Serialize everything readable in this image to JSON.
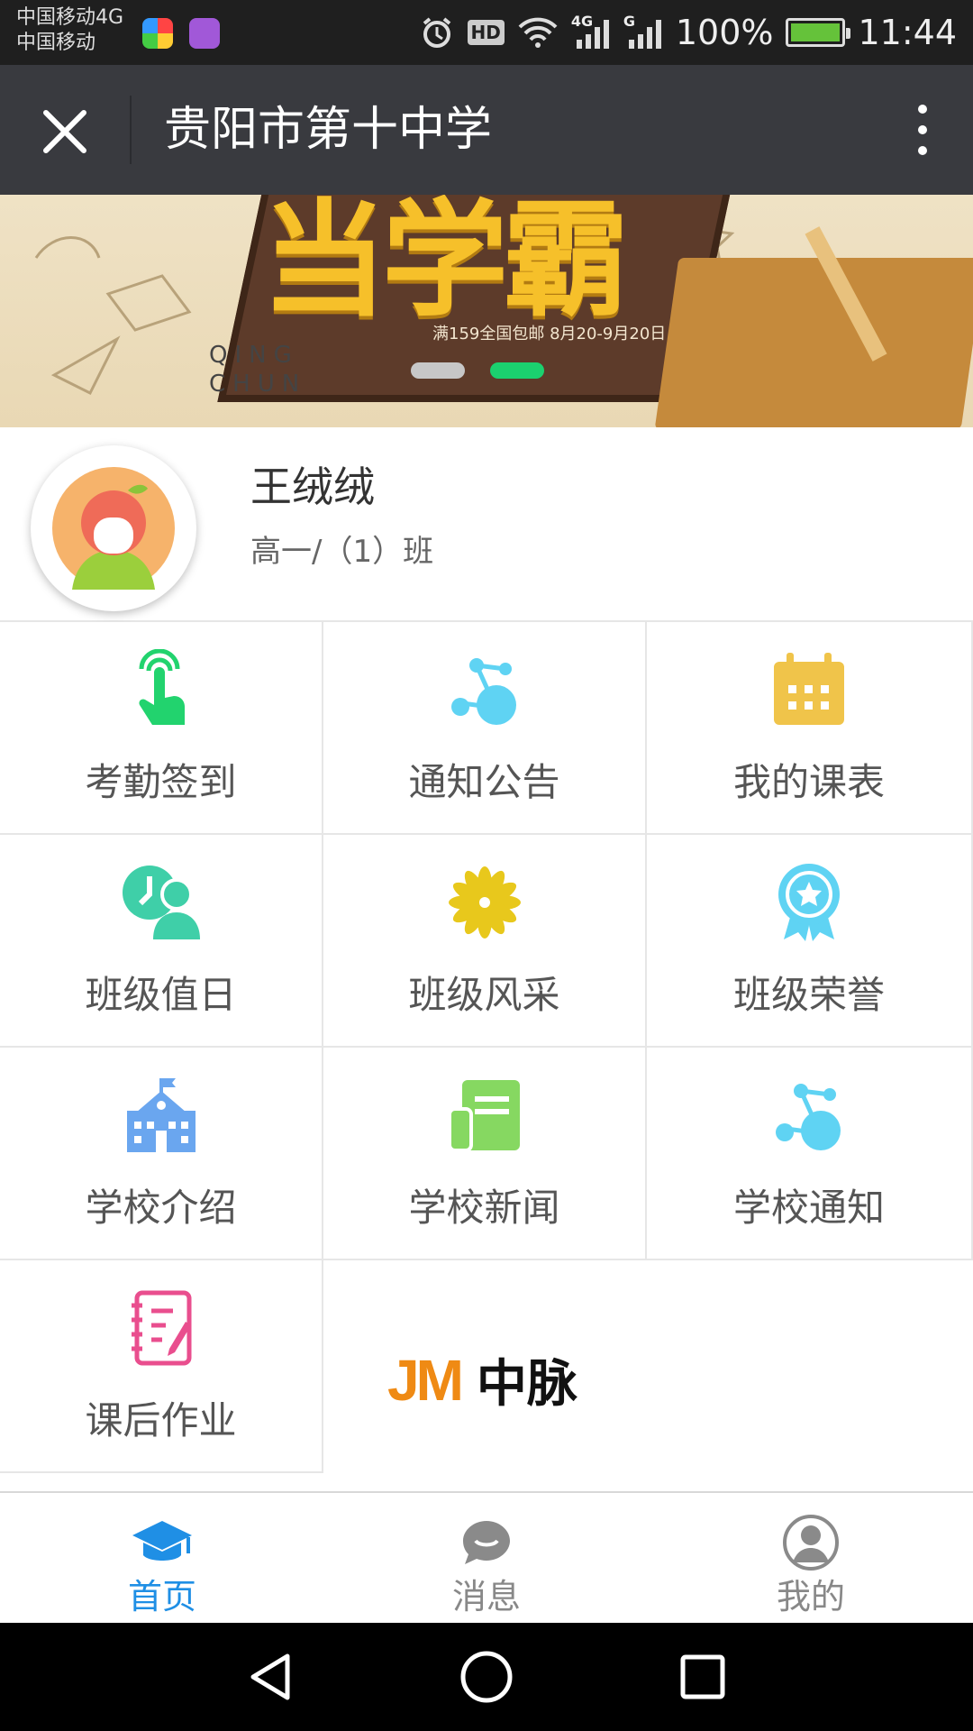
{
  "status_bar": {
    "carrier_1": "中国移动4G",
    "carrier_2": "中国移动",
    "hd": "HD",
    "net_1": "4G",
    "net_2": "G",
    "battery_percent": "100%",
    "time": "11:44"
  },
  "titlebar": {
    "title": "贵阳市第十中学",
    "close_icon": "close-icon",
    "more_icon": "more-vertical-icon"
  },
  "banner": {
    "headline": "当学霸",
    "promo": "满159全国包邮 8月20-9月20日",
    "qing": "QING",
    "chun": "CHUN",
    "slides": [
      {
        "active": false
      },
      {
        "active": true
      }
    ]
  },
  "profile": {
    "name": "王绒绒",
    "class": "高一/（1）班"
  },
  "menu": [
    {
      "label": "考勤签到",
      "icon": "tap-finger-icon",
      "color": "#22d36e"
    },
    {
      "label": "通知公告",
      "icon": "molecule-icon",
      "color": "#5fd3f3"
    },
    {
      "label": "我的课表",
      "icon": "calendar-icon",
      "color": "#f0c44a"
    },
    {
      "label": "班级值日",
      "icon": "clock-person-icon",
      "color": "#3fcfa8"
    },
    {
      "label": "班级风采",
      "icon": "flower-icon",
      "color": "#e8c81c"
    },
    {
      "label": "班级荣誉",
      "icon": "medal-icon",
      "color": "#5fd3f3"
    },
    {
      "label": "学校介绍",
      "icon": "school-building-icon",
      "color": "#6aa6ef"
    },
    {
      "label": "学校新闻",
      "icon": "newspaper-icon",
      "color": "#86d861"
    },
    {
      "label": "学校通知",
      "icon": "molecule-icon",
      "color": "#5fd3f3"
    },
    {
      "label": "课后作业",
      "icon": "notebook-icon",
      "color": "#e94e8e"
    }
  ],
  "logo": {
    "jm": "JM",
    "text": "中脉"
  },
  "tabbar": [
    {
      "label": "首页",
      "icon": "graduation-cap-icon",
      "active": true
    },
    {
      "label": "消息",
      "icon": "chat-bubble-icon",
      "active": false
    },
    {
      "label": "我的",
      "icon": "user-circle-icon",
      "active": false
    }
  ],
  "colors": {
    "accent": "#1f8fe5",
    "titlebar": "#393a3f",
    "active_dot": "#1bd16f"
  }
}
